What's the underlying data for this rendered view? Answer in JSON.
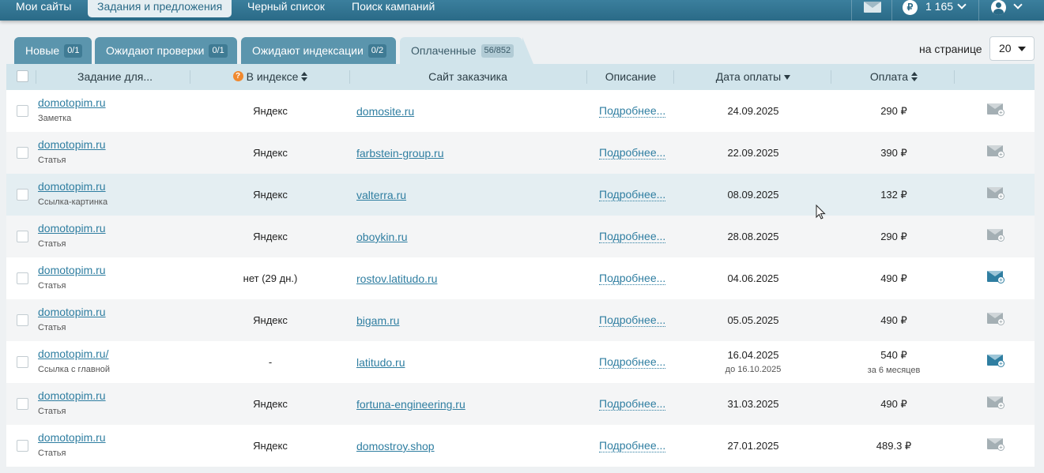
{
  "topnav": {
    "items": [
      "Мои сайты",
      "Задания и предложения",
      "Черный список",
      "Поиск кампаний"
    ],
    "active_index": 1,
    "balance": "1 165",
    "currency_symbol": "₽"
  },
  "tabs": [
    {
      "label": "Новые",
      "badge": "0/1"
    },
    {
      "label": "Ожидают проверки",
      "badge": "0/1"
    },
    {
      "label": "Ожидают индексации",
      "badge": "0/2"
    },
    {
      "label": "Оплаченные",
      "badge": "56/852"
    }
  ],
  "per_page": {
    "label": "на странице",
    "value": "20"
  },
  "columns": {
    "task": "Задание для...",
    "index_help": "?",
    "index": "В индексе",
    "customer_site": "Сайт заказчика",
    "description": "Описание",
    "payment_date": "Дата оплаты",
    "payment": "Оплата"
  },
  "rows": [
    {
      "site": "domotopim.ru",
      "type": "Заметка",
      "index": "Яндекс",
      "customer": "domosite.ru",
      "desc": "Подробнее...",
      "date": "24.09.2025",
      "date_sub": "",
      "pay": "290 ₽",
      "pay_sub": "",
      "mail": "gray"
    },
    {
      "site": "domotopim.ru",
      "type": "Статья",
      "index": "Яндекс",
      "customer": "farbstein-group.ru",
      "desc": "Подробнее...",
      "date": "22.09.2025",
      "date_sub": "",
      "pay": "390 ₽",
      "pay_sub": "",
      "mail": "gray"
    },
    {
      "site": "domotopim.ru",
      "type": "Ссылка-картинка",
      "index": "Яндекс",
      "customer": "valterra.ru",
      "desc": "Подробнее...",
      "date": "08.09.2025",
      "date_sub": "",
      "pay": "132 ₽",
      "pay_sub": "",
      "mail": "gray"
    },
    {
      "site": "domotopim.ru",
      "type": "Статья",
      "index": "Яндекс",
      "customer": "oboykin.ru",
      "desc": "Подробнее...",
      "date": "28.08.2025",
      "date_sub": "",
      "pay": "290 ₽",
      "pay_sub": "",
      "mail": "gray"
    },
    {
      "site": "domotopim.ru",
      "type": "Статья",
      "index": "нет (29 дн.)",
      "customer": "rostov.latitudo.ru",
      "desc": "Подробнее...",
      "date": "04.06.2025",
      "date_sub": "",
      "pay": "490 ₽",
      "pay_sub": "",
      "mail": "blue"
    },
    {
      "site": "domotopim.ru",
      "type": "Статья",
      "index": "Яндекс",
      "customer": "bigam.ru",
      "desc": "Подробнее...",
      "date": "05.05.2025",
      "date_sub": "",
      "pay": "490 ₽",
      "pay_sub": "",
      "mail": "gray"
    },
    {
      "site": "domotopim.ru/",
      "type": "Ссылка с главной",
      "index": "-",
      "customer": "latitudo.ru",
      "desc": "Подробнее...",
      "date": "16.04.2025",
      "date_sub": "до 16.10.2025",
      "pay": "540 ₽",
      "pay_sub": "за 6 месяцев",
      "mail": "blue"
    },
    {
      "site": "domotopim.ru",
      "type": "Статья",
      "index": "Яндекс",
      "customer": "fortuna-engineering.ru",
      "desc": "Подробнее...",
      "date": "31.03.2025",
      "date_sub": "",
      "pay": "490 ₽",
      "pay_sub": "",
      "mail": "gray"
    },
    {
      "site": "domotopim.ru",
      "type": "Статья",
      "index": "Яндекс",
      "customer": "domostroy.shop",
      "desc": "Подробнее...",
      "date": "27.01.2025",
      "date_sub": "",
      "pay": "489.3 ₽",
      "pay_sub": "",
      "mail": "gray"
    }
  ]
}
